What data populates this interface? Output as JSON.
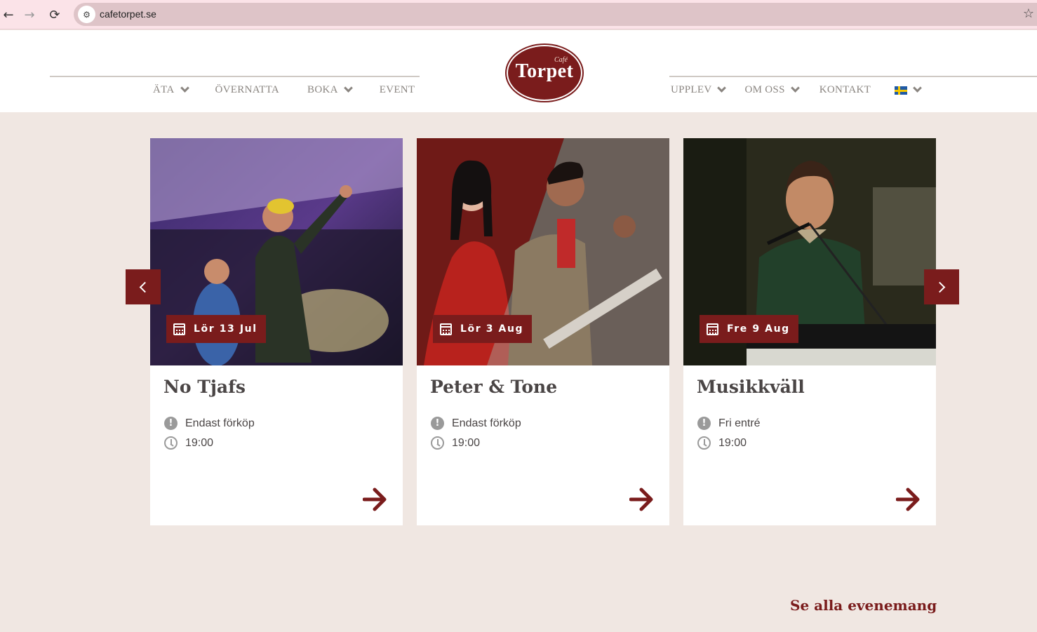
{
  "browser": {
    "url": "cafetorpet.se",
    "back_glyph": "←",
    "forward_glyph": "→",
    "reload_glyph": "⟳",
    "star_glyph": "☆",
    "site_info_glyph": "⚙"
  },
  "header": {
    "logo": {
      "small": "Café",
      "main": "Torpet"
    },
    "menu_left": [
      {
        "label": "ÄTA",
        "has_dropdown": true
      },
      {
        "label": "ÖVERNATTA",
        "has_dropdown": false
      },
      {
        "label": "BOKA",
        "has_dropdown": true
      },
      {
        "label": "EVENT",
        "has_dropdown": false
      }
    ],
    "menu_right": [
      {
        "label": "UPPLEV",
        "has_dropdown": true
      },
      {
        "label": "OM OSS",
        "has_dropdown": true
      },
      {
        "label": "KONTAKT",
        "has_dropdown": false
      },
      {
        "label": "",
        "icon": "sweden-flag-icon",
        "has_dropdown": true
      }
    ]
  },
  "events": [
    {
      "date": "Lör 13 Jul",
      "title": "No Tjafs",
      "note": "Endast förköp",
      "time": "19:00"
    },
    {
      "date": "Lör 3 Aug",
      "title": "Peter & Tone",
      "note": "Endast förköp",
      "time": "19:00"
    },
    {
      "date": "Fre 9 Aug",
      "title": "Musikkväll",
      "note": "Fri entré",
      "time": "19:00"
    }
  ],
  "see_all": "Se alla evenemang",
  "colors": {
    "brand": "#7a1c1c",
    "page_bg": "#f0e7e2",
    "text": "#4a4545",
    "muted": "#9a9a9a"
  }
}
